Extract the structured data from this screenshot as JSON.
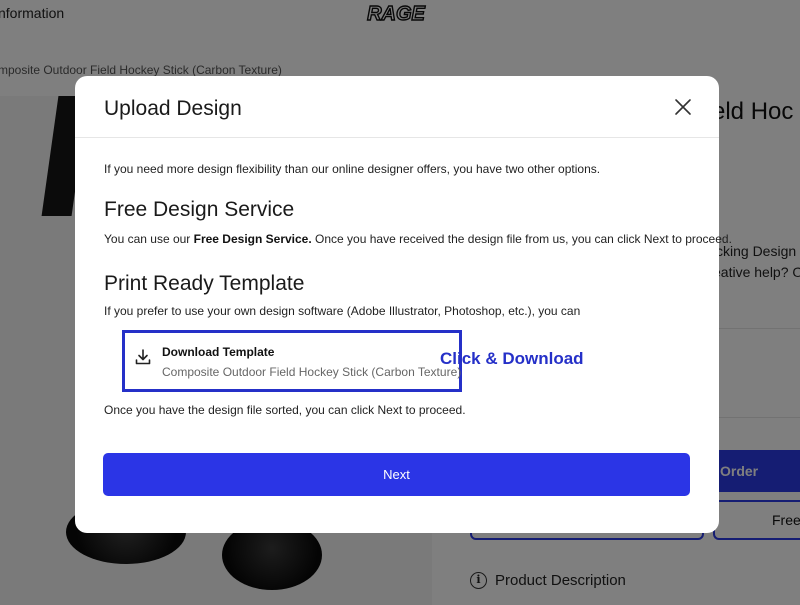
{
  "background": {
    "info_text": "nformation",
    "logo_text": "RAGE",
    "breadcrumb": "mposite Outdoor Field Hockey Stick (Carbon Texture)",
    "product_title": "eld Hoc",
    "side_line1": "cking Design &",
    "side_line2": "eative help? Or",
    "order_label": "Order",
    "free_label": "Free",
    "product_description": "Product Description",
    "info_icon": "info-circle-icon"
  },
  "modal": {
    "title": "Upload Design",
    "close_icon": "close-icon",
    "intro": "If you need more design flexibility than our online designer offers, you have two other options.",
    "free_service": {
      "heading": "Free Design Service",
      "text_before": "You can use our ",
      "text_bold": "Free Design Service.",
      "text_after": " Once you have received the design file from us, you can click Next to proceed."
    },
    "print_ready": {
      "heading": "Print Ready Template",
      "text": "If you prefer to use your own design software (Adobe Illustrator, Photoshop, etc.), you can"
    },
    "download": {
      "icon": "download-icon",
      "label": "Download Template",
      "subtitle": "Composite Outdoor Field Hockey Stick (Carbon Texture)"
    },
    "annotation": "Click & Download",
    "closing_text": "Once you have the design file sorted, you can click Next to proceed.",
    "next_label": "Next"
  },
  "colors": {
    "accent": "#2b35e6",
    "highlight_border": "#2530c8",
    "overlay": "rgba(0,0,0,0.5)"
  }
}
